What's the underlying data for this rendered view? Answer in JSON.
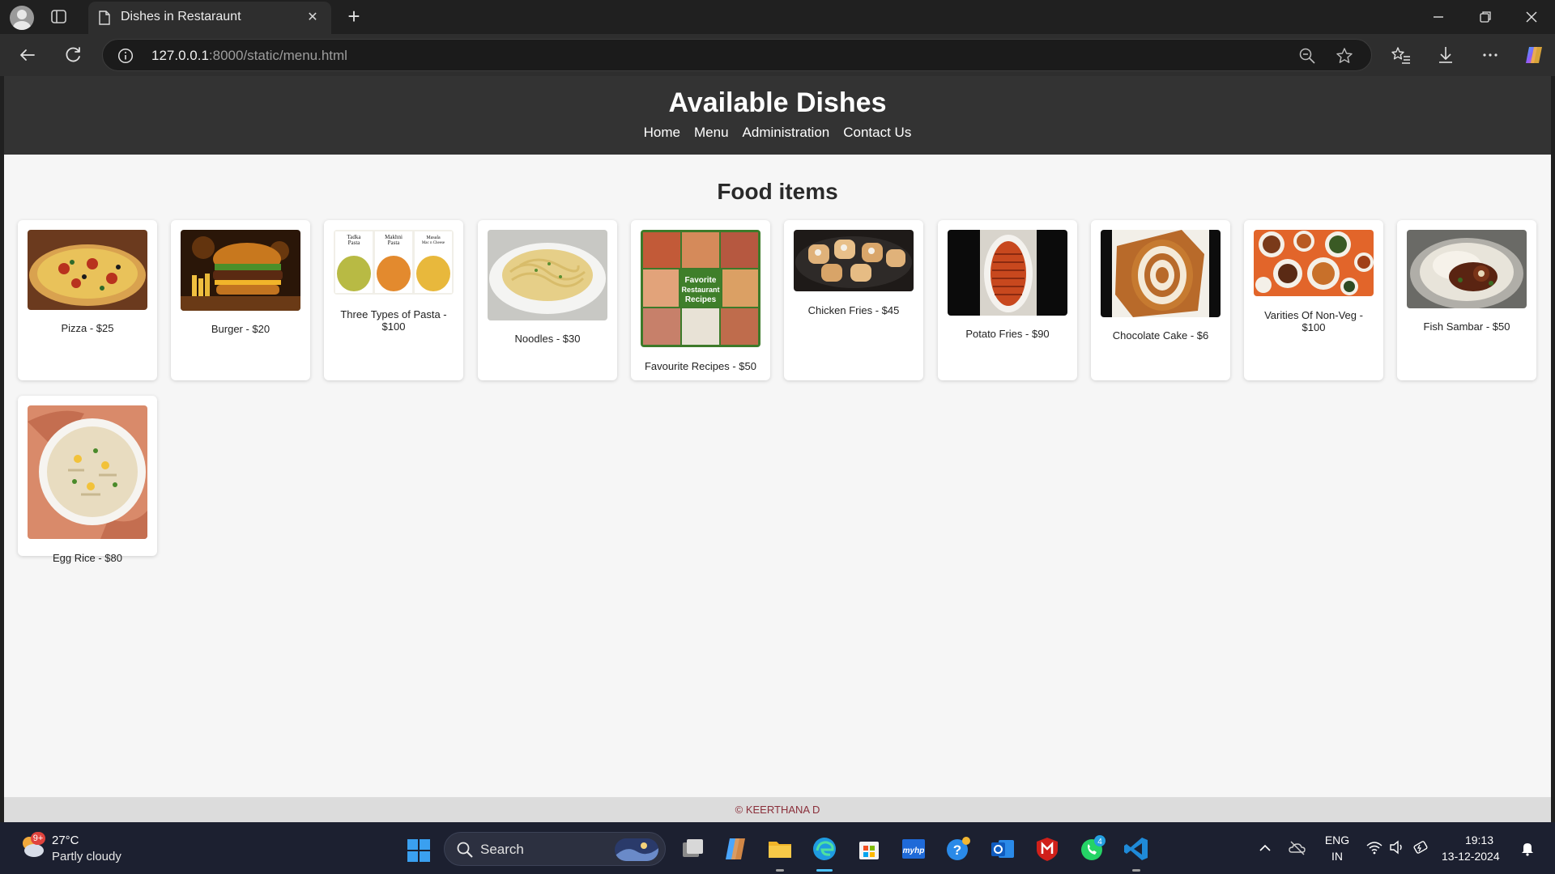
{
  "browser": {
    "tab_title": "Dishes in Restaraunt",
    "url_host": "127.0.0.1",
    "url_rest": ":8000/static/menu.html"
  },
  "page": {
    "header_title": "Available Dishes",
    "nav": [
      "Home",
      "Menu",
      "Administration",
      "Contact Us"
    ],
    "section_title": "Food items",
    "dishes": [
      {
        "label": "Pizza - $25",
        "image": "pizza"
      },
      {
        "label": "Burger - $20",
        "image": "burger"
      },
      {
        "label": "Three Types of Pasta - $100",
        "image": "three-pastas",
        "image_text": [
          "Tadka Pasta",
          "Makhni Pasta",
          "Masala Mac n Cheese"
        ]
      },
      {
        "label": "Noodles - $30",
        "image": "noodles"
      },
      {
        "label": "Favourite Recipes - $50",
        "image": "recipes-collage",
        "image_text": [
          "Favorite",
          "Restaurant",
          "Recipes"
        ]
      },
      {
        "label": "Chicken Fries - $45",
        "image": "chicken-fries"
      },
      {
        "label": "Potato Fries - $90",
        "image": "potato-fries"
      },
      {
        "label": "Chocolate Cake - $6",
        "image": "chocolate-cake"
      },
      {
        "label": "Varities Of Non-Veg - $100",
        "image": "non-veg-spread"
      },
      {
        "label": "Fish Sambar - $50",
        "image": "fish-sambar"
      },
      {
        "label": "Egg Rice - $80",
        "image": "egg-rice"
      }
    ],
    "footer": "© KEERTHANA D"
  },
  "taskbar": {
    "weather_temp": "27°C",
    "weather_desc": "Partly cloudy",
    "weather_badge": "9+",
    "search_label": "Search",
    "whatsapp_badge": "4",
    "language": "ENG",
    "region": "IN",
    "time": "19:13",
    "date": "13-12-2024"
  }
}
